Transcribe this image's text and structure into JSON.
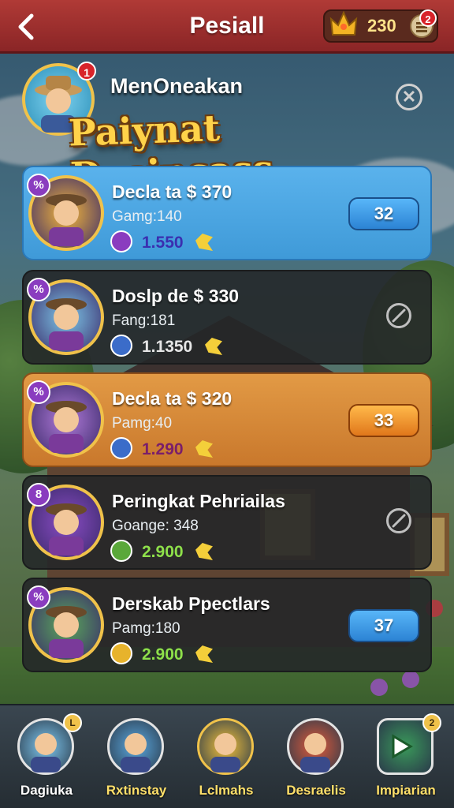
{
  "topbar": {
    "title": "Pesiall",
    "coins": "230",
    "alert_count": "2"
  },
  "header": {
    "player_name": "MenOneakan",
    "badge": "1",
    "banner": "Paiynat Decincass"
  },
  "cards": [
    {
      "tag": "%",
      "title": "Decla ta $ 370",
      "subtitle": "Gamg:140",
      "value": "1.550",
      "action": "32",
      "style": "blue",
      "gem_color": "#8a3cbf",
      "value_color": "#3a2fb0"
    },
    {
      "tag": "%",
      "title": "Doslp de $ 330",
      "subtitle": "Fang:181",
      "value": "1.1350",
      "action": "",
      "style": "dark",
      "gem_color": "#3b6cc9",
      "value_color": "#e6e6e6"
    },
    {
      "tag": "%",
      "title": "Decla ta $ 320",
      "subtitle": "Pamg:40",
      "value": "1.290",
      "action": "33",
      "style": "orange",
      "gem_color": "#3b6cc9",
      "value_color": "#7a1e6a"
    },
    {
      "tag": "8",
      "title": "Peringkat Pehriailas",
      "subtitle": "Goange: 348",
      "value": "2.900",
      "action": "",
      "style": "dark",
      "gem_color": "#5aa83a",
      "value_color": "#8ee04a"
    },
    {
      "tag": "%",
      "title": "Derskab Ppectlars",
      "subtitle": "Pamg:180",
      "value": "2.900",
      "action": "37",
      "style": "dark",
      "gem_color": "#e7b32c",
      "value_color": "#8ee04a"
    }
  ],
  "nav": [
    {
      "label": "Dagiuka",
      "label_color": "#ffffff",
      "badge": "L"
    },
    {
      "label": "Rxtinstay",
      "label_color": "#ffe06a",
      "badge": ""
    },
    {
      "label": "Lclmahs",
      "label_color": "#ffe06a",
      "badge": ""
    },
    {
      "label": "Desraelis",
      "label_color": "#ffe06a",
      "badge": ""
    },
    {
      "label": "Impiarian",
      "label_color": "#ffe06a",
      "badge": "2"
    }
  ]
}
